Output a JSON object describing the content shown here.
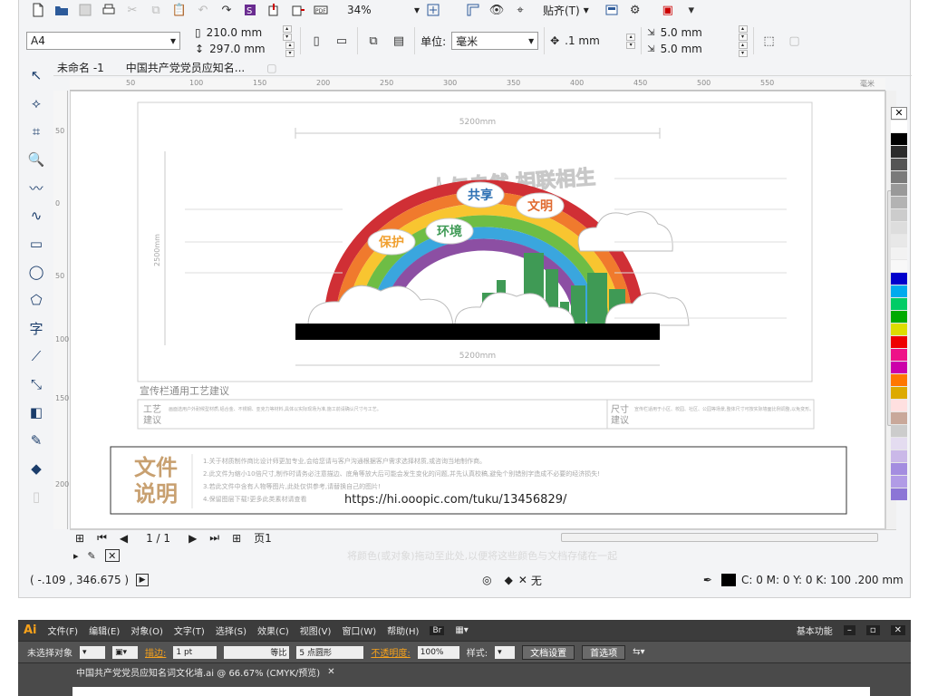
{
  "toolbar1": {
    "zoom": "34%",
    "snap_label": "贴齐(T)"
  },
  "toolbar2": {
    "page_size": "A4",
    "width": "210.0 mm",
    "height": "297.0 mm",
    "units_label": "单位:",
    "units_value": "毫米",
    "nudge": ".1 mm",
    "dup_x": "5.0 mm",
    "dup_y": "5.0 mm"
  },
  "tabs": [
    "未命名 -1",
    "中国共产党党员应知名..."
  ],
  "rulers": {
    "h": [
      "50",
      "100",
      "150",
      "200",
      "250",
      "300",
      "350",
      "400",
      "450",
      "500",
      "550"
    ],
    "h_unit": "毫米",
    "v": [
      "50",
      "0",
      "50",
      "100",
      "150",
      "200"
    ]
  },
  "design": {
    "dim_top": "5200mm",
    "dim_bottom": "5200mm",
    "dim_left": "2500mm",
    "title_arc": "人与自然 相联相生",
    "cloud_words": [
      "保护",
      "环境",
      "共享",
      "文明"
    ],
    "section_title": "宣传栏通用工艺建议",
    "craft_label": "工艺\n建议",
    "craft_label_right": "尺寸\n建议",
    "craft_desc": "画面选用户外耐候型材质,铝合金、不锈钢、亚克力等材料,具体以实际现场为准,施工前请确认尺寸与工艺。",
    "size_desc": "宣传栏适用于小区、校园、社区、公园等场景,整体尺寸可按实际墙面比例调整,以免变形。",
    "file_label": "文件\n说明",
    "file_lines": [
      "1.关于材质制作商比设计师更加专业,会给您请与客户沟通根据客户需求选择材质,或咨询当地制作商。",
      "2.此文件为缩小10倍尺寸,制作时请务必注意描边、底角等放大后可能会发生变化的问题,并先认真校稿,避免个别错别字造成不必要的经济损失!",
      "3.若此文件中含有人物等图片,此处仅供参考,请替换自己的图片!",
      "4.保留图层下载!更多此类素材请查看"
    ],
    "url": "https://hi.ooopic.com/tuku/13456829/"
  },
  "bottom_nav": {
    "page_count": "1 / 1",
    "page_tab": "页1"
  },
  "hint": "将颜色(或对象)拖动至此处,以便将这些颜色与文档存储在一起",
  "status": {
    "coords": "( -.109 , 346.675 )",
    "fill": "无",
    "outline": "C: 0 M: 0 Y: 0 K: 100  .200 mm"
  },
  "palette": [
    "#ffffff",
    "#000000",
    "#2b2b2b",
    "#555555",
    "#7a7a7a",
    "#999999",
    "#b3b3b3",
    "#cccccc",
    "#dddddd",
    "#e8e8e8",
    "#f2f2f2",
    "#f8f8f8",
    "#0000cc",
    "#00aaee",
    "#00cc66",
    "#00aa00",
    "#dddd00",
    "#ee0000",
    "#ee1188",
    "#cc00aa",
    "#ff7700",
    "#ddaa00",
    "#ffe0e0",
    "#c9a89a",
    "#cccccc",
    "#e4dcf0",
    "#cab8e8",
    "#a48de0",
    "#b19be6",
    "#8c75d6"
  ],
  "illustrator": {
    "logo": "Ai",
    "menu": [
      "文件(F)",
      "编辑(E)",
      "对象(O)",
      "文字(T)",
      "选择(S)",
      "效果(C)",
      "视图(V)",
      "窗口(W)",
      "帮助(H)"
    ],
    "workspace": "基本功能",
    "selection": "未选择对象",
    "stroke_label": "描边:",
    "stroke_value": "1 pt",
    "line_style": "等比",
    "brush": "5 点圆形",
    "opacity_label": "不透明度:",
    "opacity_value": "100%",
    "style_label": "样式:",
    "doc_settings": "文档设置",
    "prefs": "首选项",
    "doc_tab": "中国共产党党员应知名词文化墙.ai @ 66.67% (CMYK/预览)"
  }
}
